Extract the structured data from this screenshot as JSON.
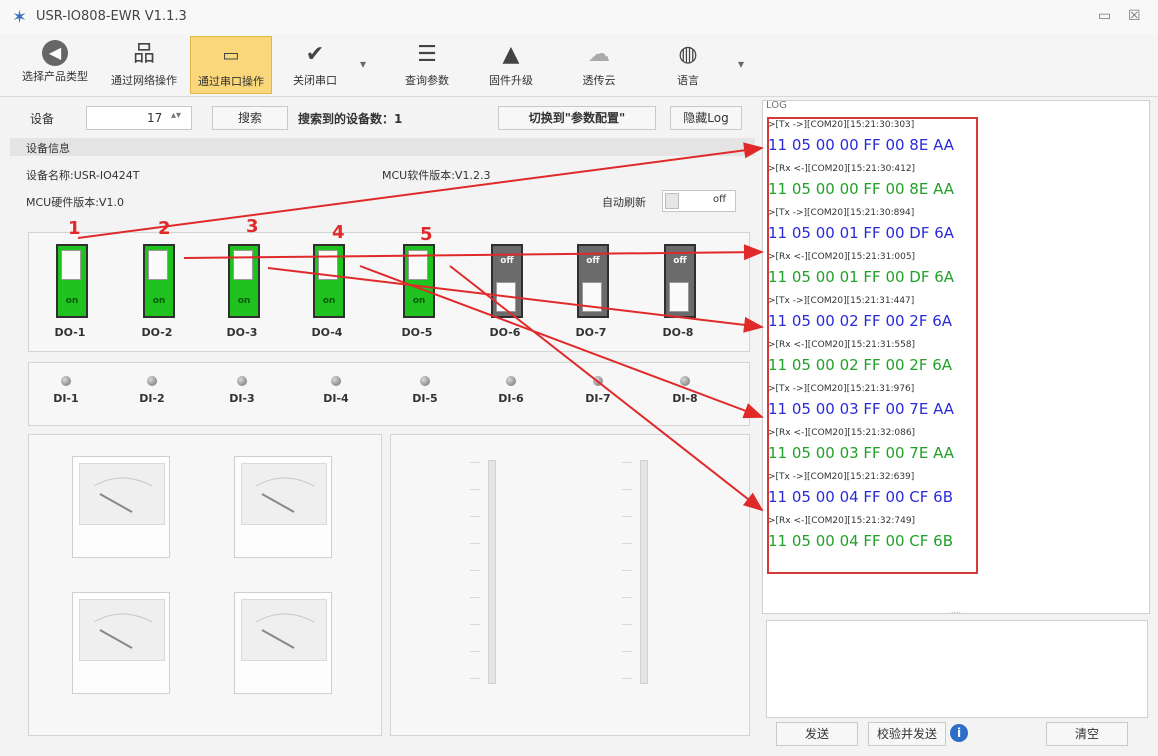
{
  "window": {
    "title": "USR-IO808-EWR V1.1.3",
    "min_label": "▭",
    "close_label": "☒"
  },
  "toolbar": {
    "items": [
      {
        "label": "选择产品类型"
      },
      {
        "label": "通过网络操作"
      },
      {
        "label": "通过串口操作"
      },
      {
        "label": "关闭串口"
      },
      {
        "label": "查询参数"
      },
      {
        "label": "固件升级"
      },
      {
        "label": "透传云"
      },
      {
        "label": "语言"
      }
    ],
    "dropdown_glyph": "▾"
  },
  "device": {
    "label": "设备",
    "number": "17",
    "search_label": "搜索",
    "found_text": "搜索到的设备数：1",
    "switch_label": "切换到\"参数配置\"",
    "hide_log_label": "隐藏Log"
  },
  "info": {
    "section": "设备信息",
    "name": "设备名称:USR-IO424T",
    "mcu_sw": "MCU软件版本:V1.2.3",
    "mcu_hw": "MCU硬件版本:V1.0",
    "auto_refresh": "自动刷新",
    "auto_refresh_state": "off"
  },
  "outputs": [
    {
      "label": "DO-1",
      "state": "on"
    },
    {
      "label": "DO-2",
      "state": "on"
    },
    {
      "label": "DO-3",
      "state": "on"
    },
    {
      "label": "DO-4",
      "state": "on"
    },
    {
      "label": "DO-5",
      "state": "on"
    },
    {
      "label": "DO-6",
      "state": "off"
    },
    {
      "label": "DO-7",
      "state": "off"
    },
    {
      "label": "DO-8",
      "state": "off"
    }
  ],
  "inputs": [
    "DI-1",
    "DI-2",
    "DI-3",
    "DI-4",
    "DI-5",
    "DI-6",
    "DI-7",
    "DI-8"
  ],
  "annotations": [
    "1",
    "2",
    "3",
    "4",
    "5"
  ],
  "log": {
    "title": "LOG",
    "entries": [
      {
        "meta": ">[Tx ->][COM20][15:21:30:303]",
        "data": "11 05 00 00 FF 00 8E AA",
        "dir": "tx"
      },
      {
        "meta": ">[Rx <-][COM20][15:21:30:412]",
        "data": "11 05 00 00 FF 00 8E AA",
        "dir": "rx"
      },
      {
        "meta": ">[Tx ->][COM20][15:21:30:894]",
        "data": "11 05 00 01 FF 00 DF 6A",
        "dir": "tx"
      },
      {
        "meta": ">[Rx <-][COM20][15:21:31:005]",
        "data": "11 05 00 01 FF 00 DF 6A",
        "dir": "rx"
      },
      {
        "meta": ">[Tx ->][COM20][15:21:31:447]",
        "data": "11 05 00 02 FF 00 2F 6A",
        "dir": "tx"
      },
      {
        "meta": ">[Rx <-][COM20][15:21:31:558]",
        "data": "11 05 00 02 FF 00 2F 6A",
        "dir": "rx"
      },
      {
        "meta": ">[Tx ->][COM20][15:21:31:976]",
        "data": "11 05 00 03 FF 00 7E AA",
        "dir": "tx"
      },
      {
        "meta": ">[Rx <-][COM20][15:21:32:086]",
        "data": "11 05 00 03 FF 00 7E AA",
        "dir": "rx"
      },
      {
        "meta": ">[Tx ->][COM20][15:21:32:639]",
        "data": "11 05 00 04 FF 00 CF 6B",
        "dir": "tx"
      },
      {
        "meta": ">[Rx <-][COM20][15:21:32:749]",
        "data": "11 05 00 04 FF 00 CF 6B",
        "dir": "rx"
      }
    ],
    "splitter_dots": "....",
    "send_label": "发送",
    "checksum_send_label": "校验并发送",
    "info_glyph": "i",
    "clear_label": "清空"
  },
  "colors": {
    "tx": "#2b2bd8",
    "rx": "#21a02a",
    "annotation": "#e02a2a",
    "active_tool": "#f9d77a",
    "switch_on": "#1fc21f"
  }
}
